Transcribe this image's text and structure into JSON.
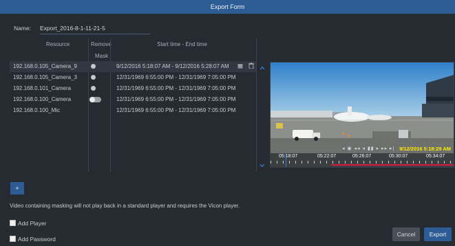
{
  "window": {
    "title": "Export Form"
  },
  "form": {
    "name_label": "Name:",
    "name_value": "Export_2016-8-1-11-21-5"
  },
  "table": {
    "col_resource": "Resource",
    "col_remove": "Remove",
    "col_mask": "Mask",
    "col_time": "Start time - End time",
    "rows": [
      {
        "resource": "192.168.0.105_Camera_9",
        "time": "9/12/2016 5:18:07 AM - 9/12/2016 5:28:07 AM",
        "mask": "dot",
        "selected": true
      },
      {
        "resource": "192.168.0.105_Camera_3",
        "time": "12/31/1969 6:55:00 PM - 12/31/1969 7:05:00 PM",
        "mask": "dot"
      },
      {
        "resource": "192.168.0.101_Camera",
        "time": "12/31/1969 6:55:00 PM - 12/31/1969 7:05:00 PM",
        "mask": "dot"
      },
      {
        "resource": "192.168.0.100_Camera",
        "time": "12/31/1969 6:55:00 PM - 12/31/1969 7:05:00 PM",
        "mask": "toggle"
      },
      {
        "resource": "192.168.0.100_Mic",
        "time": "12/31/1969 6:55:00 PM - 12/31/1969 7:05:00 PM",
        "mask": "none"
      }
    ]
  },
  "preview": {
    "timestamp": "9/12/2016 5:18:29 AM",
    "timeline_labels": [
      "05:18:07",
      "05:22:07",
      "05:26:07",
      "05:30:07",
      "05:34:07"
    ],
    "icons": [
      "calendar-icon",
      "trash-icon",
      "chevron-up-icon",
      "chevron-down-icon"
    ]
  },
  "actions": {
    "add_label": "+",
    "note": "Video containing masking will not play back in a standard player and requires the Vicon player.",
    "add_player": "Add Player",
    "add_password": "Add Password",
    "cancel": "Cancel",
    "export": "Export"
  },
  "colors": {
    "accent": "#2d5c94",
    "background": "#262a31",
    "timeline_red": "#e0193a",
    "timestamp_yellow": "#ffee00"
  }
}
